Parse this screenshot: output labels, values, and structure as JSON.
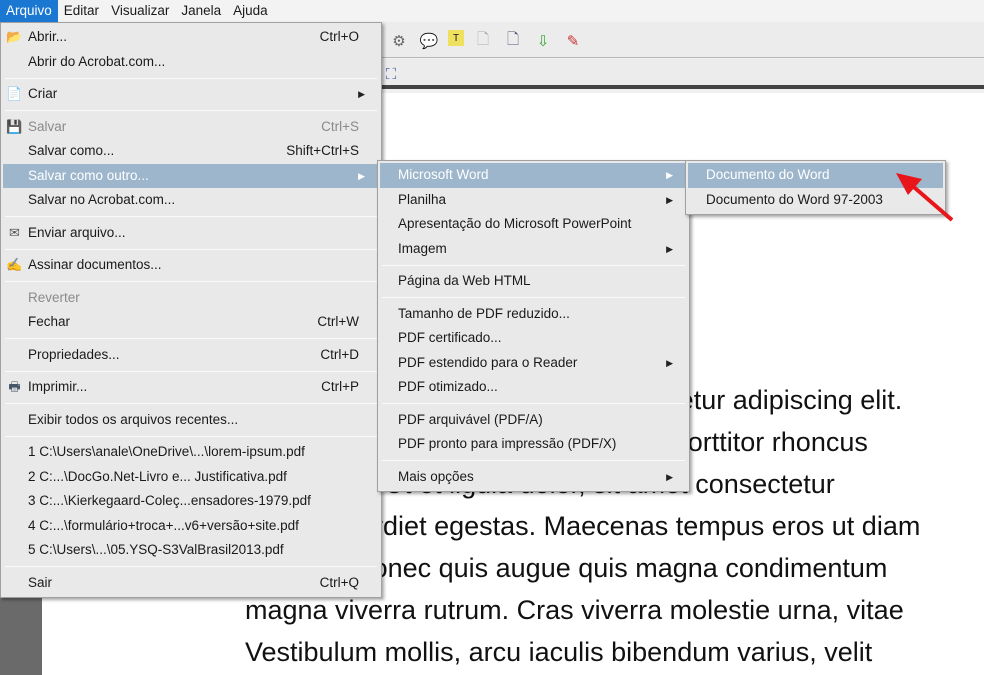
{
  "menubar": [
    "Arquivo",
    "Editar",
    "Visualizar",
    "Janela",
    "Ajuda"
  ],
  "file_menu": {
    "abrir": "Abrir...",
    "abrir_sc": "Ctrl+O",
    "abrir_acrobat": "Abrir do Acrobat.com...",
    "criar": "Criar",
    "salvar": "Salvar",
    "salvar_sc": "Ctrl+S",
    "salvar_como": "Salvar como...",
    "salvar_como_sc": "Shift+Ctrl+S",
    "salvar_outro": "Salvar como outro...",
    "salvar_acrobat": "Salvar no Acrobat.com...",
    "enviar": "Enviar arquivo...",
    "assinar": "Assinar documentos...",
    "reverter": "Reverter",
    "fechar": "Fechar",
    "fechar_sc": "Ctrl+W",
    "propriedades": "Propriedades...",
    "propriedades_sc": "Ctrl+D",
    "imprimir": "Imprimir...",
    "imprimir_sc": "Ctrl+P",
    "exibir_recentes": "Exibir todos os arquivos recentes...",
    "recent": [
      "1 C:\\Users\\anale\\OneDrive\\...\\lorem-ipsum.pdf",
      "2 C:...\\DocGo.Net-Livro e... Justificativa.pdf",
      "3 C:...\\Kierkegaard-Coleç...ensadores-1979.pdf",
      "4 C:...\\formulário+troca+...v6+versão+site.pdf",
      "5 C:\\Users\\...\\05.YSQ-S3ValBrasil2013.pdf"
    ],
    "sair": "Sair",
    "sair_sc": "Ctrl+Q"
  },
  "save_as_menu": [
    "Microsoft Word",
    "Planilha",
    "Apresentação do Microsoft PowerPoint",
    "Imagem",
    "Página da Web HTML",
    "Tamanho de PDF reduzido...",
    "PDF certificado...",
    "PDF estendido para o Reader",
    "PDF otimizado...",
    "PDF arquivável (PDF/A)",
    "PDF pronto para impressão (PDF/X)",
    "Mais opções"
  ],
  "word_menu": [
    "Documento do Word",
    "Documento do Word 97-2003"
  ],
  "document_lines": [
    "Lorem ipsum dolor sit amet, consectetur adipiscing elit.",
    "Proin nec ligula ut odio consectetur porttitor rhoncus",
    "quis lorem. Ut et ligula dolor, sit amet consectetur",
    "Nunc imperdiet egestas. Maecenas tempus eros ut diam",
    "sodales. Donec quis augue quis magna condimentum",
    "magna viverra rutrum. Cras viverra molestie urna, vitae",
    "Vestibulum mollis, arcu iaculis bibendum varius, velit"
  ],
  "colors": {
    "highlight": "#9db6cc",
    "menubar_active": "#1b78d2",
    "arrow": "#e8161b"
  }
}
